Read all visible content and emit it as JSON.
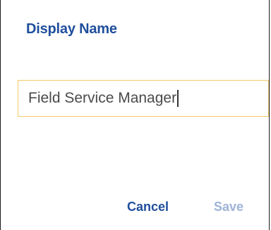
{
  "dialog": {
    "title": "Display Name",
    "field": {
      "value": "Field Service Manager",
      "focused": true
    },
    "actions": {
      "cancel_label": "Cancel",
      "save_label": "Save",
      "save_enabled": false
    }
  },
  "colors": {
    "title": "#1f4e9c",
    "primary_action": "#1f4e9c",
    "disabled_action": "#9db3d8",
    "focus_border": "#f5c86a",
    "text": "#4a4a4a"
  }
}
